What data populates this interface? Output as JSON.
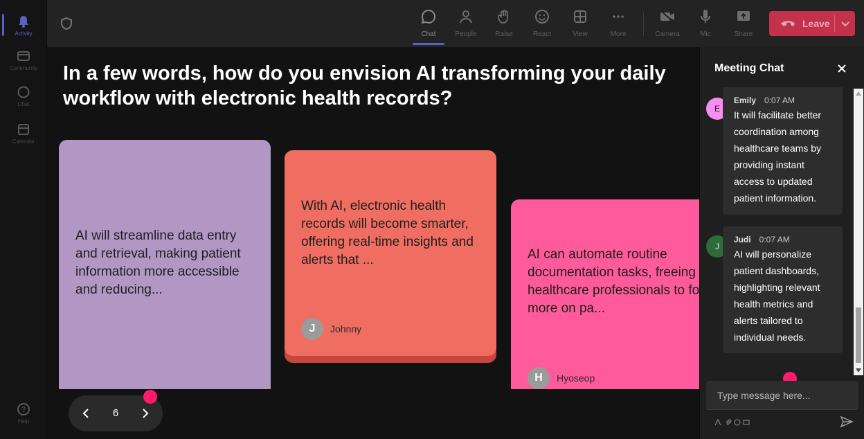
{
  "rail": {
    "items": [
      {
        "label": "Activity",
        "icon": "bell-icon"
      },
      {
        "label": "Community",
        "icon": "community-icon"
      },
      {
        "label": "Chat",
        "icon": "chat-icon"
      },
      {
        "label": "Calendar",
        "icon": "calendar-icon"
      },
      {
        "label": "Help",
        "icon": "help-icon"
      }
    ]
  },
  "toolbar": {
    "chat": "Chat",
    "people": "People",
    "raise": "Raise",
    "react": "React",
    "view": "View",
    "more": "More",
    "camera": "Camera",
    "mic": "Mic",
    "share": "Share",
    "leave": "Leave"
  },
  "stage": {
    "question": "In a few words, how do you envision AI transforming your daily workflow with electronic health records?",
    "cards": [
      {
        "text": "AI will streamline data entry and retrieval, making patient information more accessible and reducing...",
        "color": "#b297c5"
      },
      {
        "text": "With AI, electronic health records will become smarter, offering real-time insights and alerts that ...",
        "author": "Johnny",
        "initial": "J",
        "color": "#f06d61"
      },
      {
        "text": "AI can automate routine documentation tasks, freeing up healthcare professionals to focus more on pa...",
        "author": "Hyoseop",
        "initial": "H",
        "color": "#ff5a9b"
      }
    ],
    "page": "6"
  },
  "chat": {
    "title": "Meeting Chat",
    "messages": [
      {
        "name": "Emily",
        "initial": "E",
        "time": "0:07 AM",
        "text": "It will facilitate better coordination among healthcare teams by providing instant access to updated patient information."
      },
      {
        "name": "Judi",
        "initial": "J",
        "time": "0:07 AM",
        "text": "AI will personalize patient dashboards, highlighting relevant health metrics and alerts tailored to individual needs."
      }
    ],
    "placeholder": "Type message here..."
  },
  "colors": {
    "accent": "#5b5fc7",
    "leave": "#c4314b",
    "notify": "#ff1a6c"
  }
}
